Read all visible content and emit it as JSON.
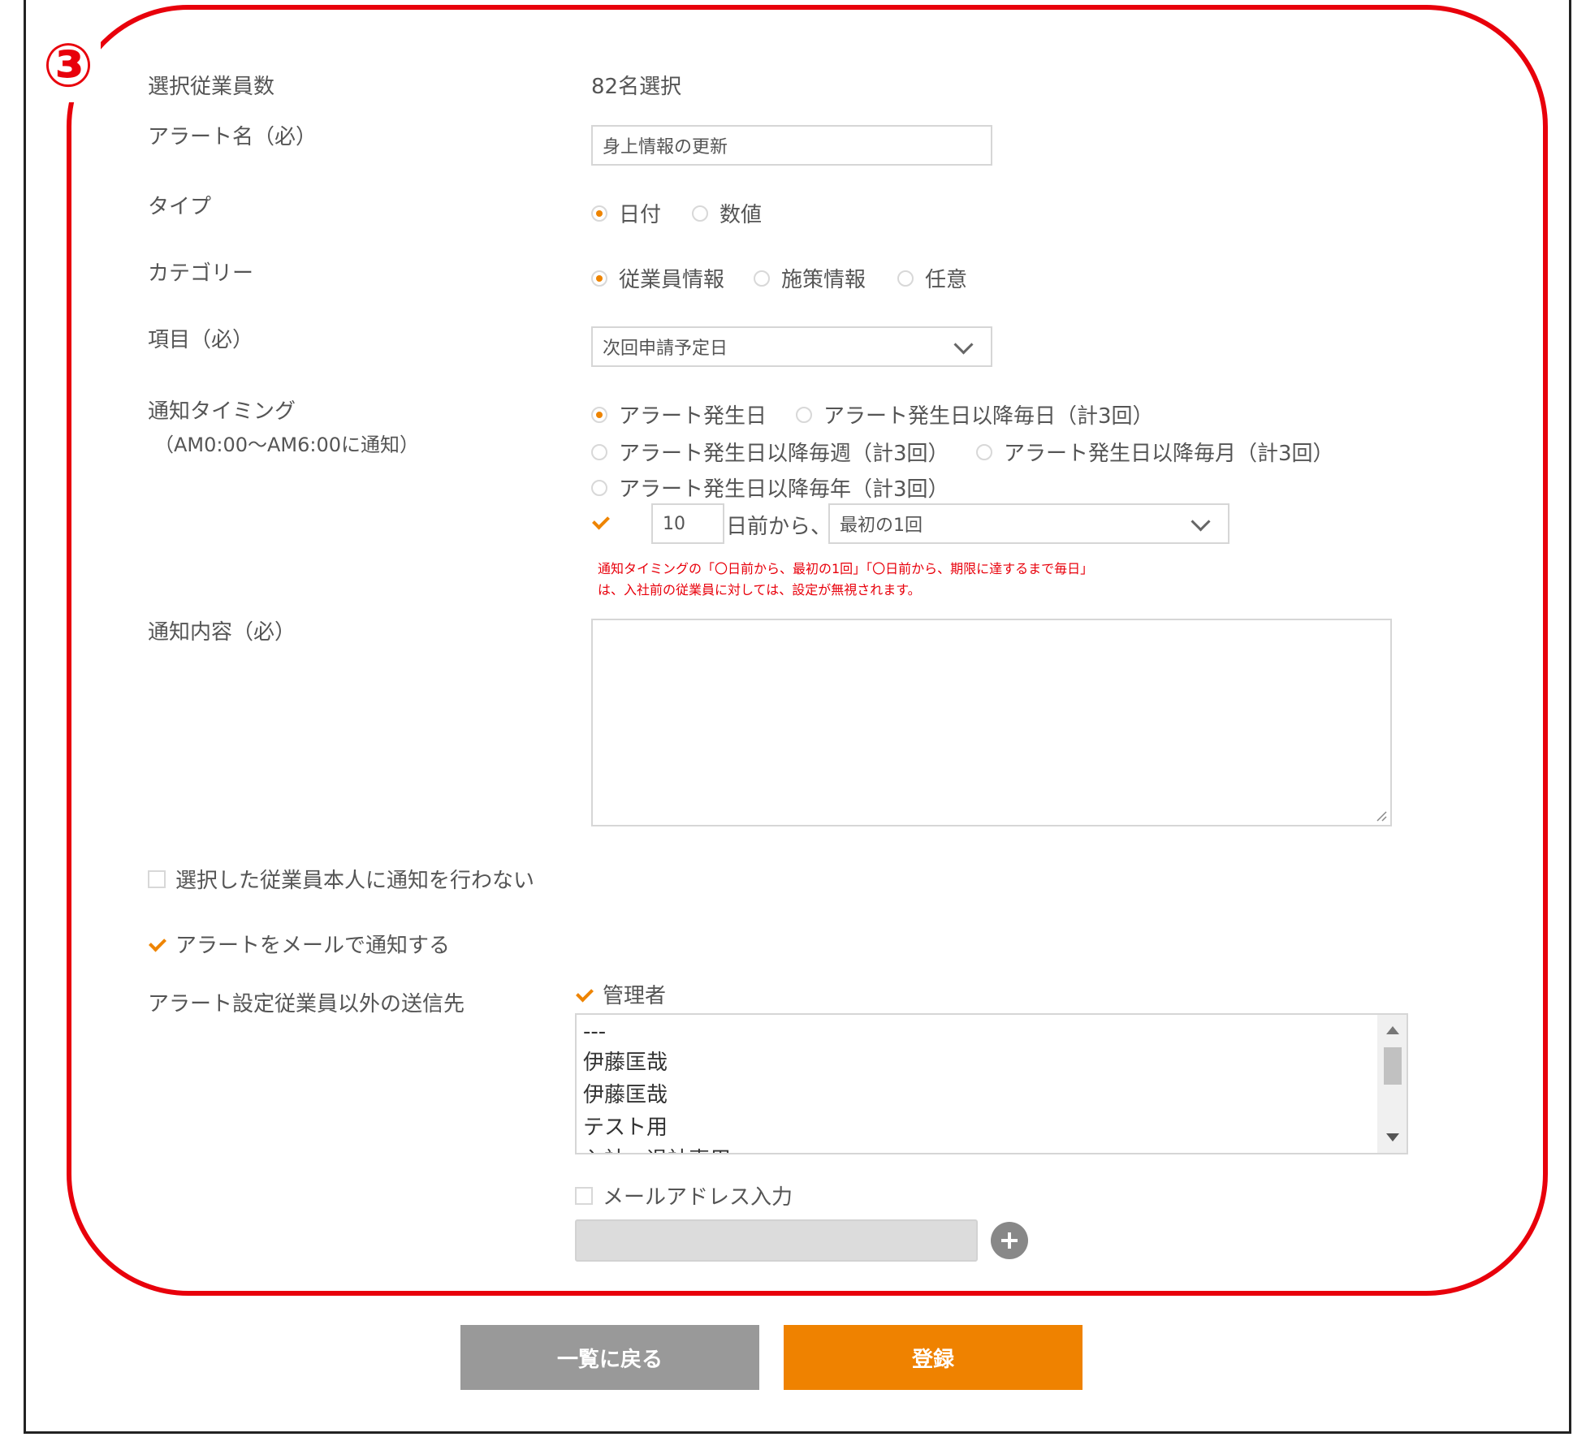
{
  "marker": "③",
  "form": {
    "selected_count": {
      "label": "選択従業員数",
      "value": "82名選択"
    },
    "alert_name": {
      "label": "アラート名（必）",
      "value": "身上情報の更新"
    },
    "type": {
      "label": "タイプ",
      "options": [
        "日付",
        "数値"
      ],
      "selected": "日付"
    },
    "category": {
      "label": "カテゴリー",
      "options": [
        "従業員情報",
        "施策情報",
        "任意"
      ],
      "selected": "従業員情報"
    },
    "item": {
      "label": "項目（必）",
      "value": "次回申請予定日"
    },
    "timing": {
      "label": "通知タイミング",
      "sublabel": "（AM0:00～AM6:00に通知）",
      "options": [
        "アラート発生日",
        "アラート発生日以降毎日（計3回）",
        "アラート発生日以降毎週（計3回）",
        "アラート発生日以降毎月（計3回）",
        "アラート発生日以降毎年（計3回）"
      ],
      "selected": "アラート発生日",
      "days_value": "10",
      "days_suffix": "日前から、",
      "frequency_value": "最初の1回",
      "note_line1": "通知タイミングの「〇日前から、最初の1回」「〇日前から、期限に達するまで毎日」",
      "note_line2": "は、入社前の従業員に対しては、設定が無視されます。"
    },
    "content": {
      "label": "通知内容（必）",
      "value": ""
    },
    "no_self_notify": {
      "label": "選択した従業員本人に通知を行わない",
      "checked": false
    },
    "email_notify": {
      "label": "アラートをメールで通知する",
      "checked": true
    },
    "recipients": {
      "label": "アラート設定従業員以外の送信先",
      "admin_label": "管理者",
      "admin_checked": true,
      "list": [
        "---",
        "伊藤匡哉",
        "伊藤匡哉",
        "テスト用",
        "入社・退社専用"
      ],
      "email_label": "メールアドレス入力",
      "email_checked": false,
      "email_value": ""
    }
  },
  "buttons": {
    "back": "一覧に戻る",
    "submit": "登録"
  },
  "colors": {
    "accent": "#ef8200",
    "highlight": "#e8000b",
    "button_gray": "#999999"
  }
}
